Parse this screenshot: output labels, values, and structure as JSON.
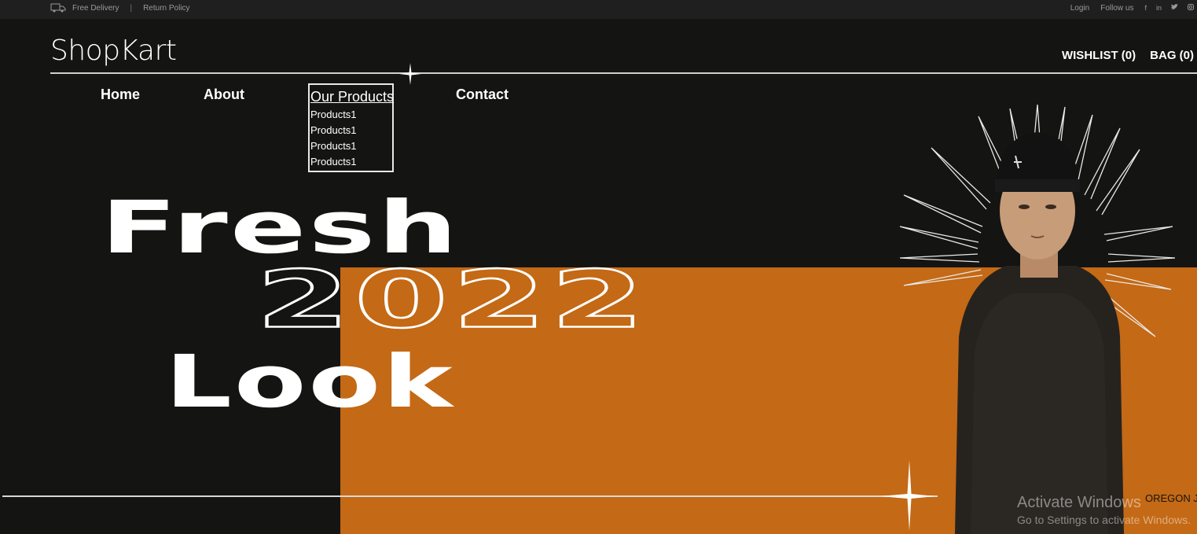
{
  "topbar": {
    "free_delivery": "Free Delivery",
    "separator": "|",
    "return_policy": "Return Policy",
    "login": "Login",
    "follow_us": "Follow us",
    "social": [
      "f",
      "in",
      "t",
      "ig"
    ]
  },
  "header": {
    "logo": "ShopKart",
    "wishlist": "WISHLIST (0)",
    "bag": "BAG (0)"
  },
  "nav": {
    "home": "Home",
    "about": "About",
    "products": "Our Products",
    "contact": "Contact",
    "product_items": [
      "Products1",
      "Products1",
      "Products1",
      "Products1"
    ]
  },
  "hero": {
    "line1": "Fresh",
    "line2": "2022",
    "line3": "Look",
    "side_label": "OREGON J"
  },
  "overlay": {
    "activate_title": "Activate Windows",
    "activate_sub": "Go to Settings to activate Windows."
  },
  "colors": {
    "background": "#141412",
    "accent_orange": "#c46915",
    "topbar": "#1f1f1f"
  }
}
